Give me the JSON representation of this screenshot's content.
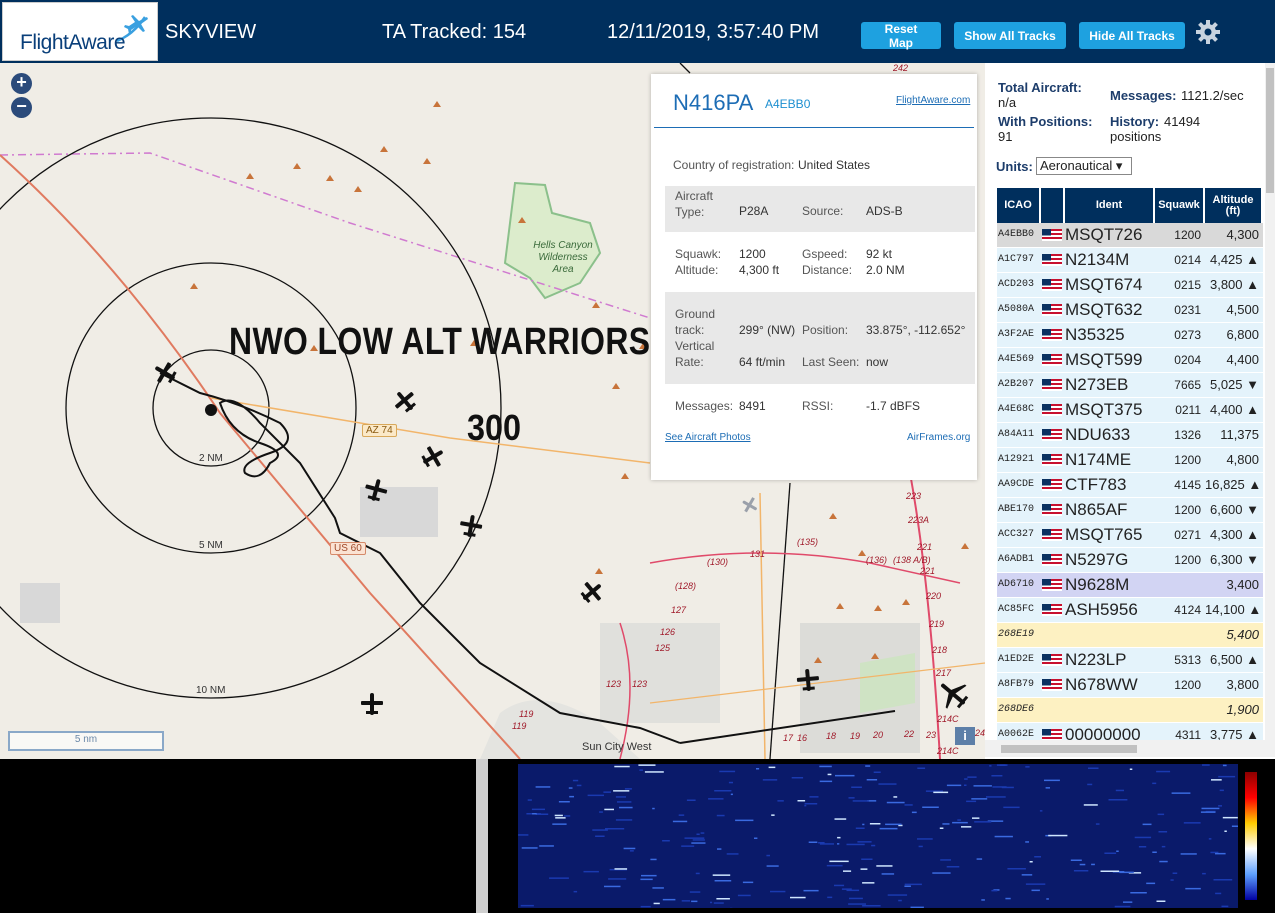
{
  "header": {
    "logo": "FlightAware",
    "app_name": "SKYVIEW",
    "tracked": "TA Tracked: 154",
    "datetime": "12/11/2019, 3:57:40 PM",
    "buttons": {
      "reset": "Reset Map",
      "show": "Show All Tracks",
      "hide": "Hide All Tracks"
    },
    "settings_icon": "gear-icon"
  },
  "map": {
    "zoom_in": "+",
    "zoom_out": "−",
    "overlay_title": "NWO LOW ALT WARRIORS",
    "overlay_number": "300",
    "rings": [
      "2 NM",
      "5 NM",
      "10 NM"
    ],
    "scale": "5 nm",
    "labels": {
      "wilderness": "Hells Canyon Wilderness Area",
      "city": "Sun City West",
      "az74": "AZ 74",
      "us60": "US 60",
      "road_242": "242",
      "route_numbers": [
        "(130)",
        "131",
        "(135)",
        "(136)",
        "(138 A/B)",
        "(128)",
        "127",
        "126",
        "125",
        "123",
        "123",
        "119",
        "119",
        "223",
        "223A",
        "221",
        "221",
        "220",
        "219",
        "218",
        "217",
        "214C",
        "214C",
        "17",
        "16",
        "18",
        "19",
        "20",
        "22",
        "23",
        "24"
      ],
      "info": "i"
    }
  },
  "popup": {
    "registration": "N416PA",
    "hex": "A4EBB0",
    "fa_link": "FlightAware.com",
    "country_label": "Country of registration:",
    "country": "United States",
    "aircraft_type_label": "Aircraft Type:",
    "aircraft_type": "P28A",
    "source_label": "Source:",
    "source": "ADS-B",
    "squawk_label": "Squawk:",
    "squawk": "1200",
    "gspeed_label": "Gspeed:",
    "gspeed": "92 kt",
    "altitude_label": "Altitude:",
    "altitude": "4,300 ft",
    "distance_label": "Distance:",
    "distance": "2.0 NM",
    "ground_track_label": "Ground track:",
    "ground_track": "299° (NW)",
    "position_label": "Position:",
    "position": "33.875°, -112.652°",
    "vrate_label": "Vertical Rate:",
    "vrate": "64 ft/min",
    "last_seen_label": "Last Seen:",
    "last_seen": "now",
    "messages_label": "Messages:",
    "messages": "8491",
    "rssi_label": "RSSI:",
    "rssi": "-1.7 dBFS",
    "photos_link": "See Aircraft Photos",
    "airframes_link": "AirFrames.org"
  },
  "stats": {
    "total_label": "Total Aircraft:",
    "total": "n/a",
    "messages_label": "Messages:",
    "messages": "1121.2/sec",
    "positions_label": "With Positions:",
    "positions": "91",
    "history_label": "History:",
    "history": "41494 positions",
    "units_label": "Units:",
    "units": "Aeronautical ▾"
  },
  "table": {
    "headers": {
      "icao": "ICAO",
      "ident": "Ident",
      "squawk": "Squawk",
      "altitude": "Altitude (ft)"
    },
    "rows": [
      {
        "icao": "A4EBB0",
        "flag": true,
        "ident": "MSQT726",
        "squawk": "1200",
        "alt": "4,300",
        "style": "selected"
      },
      {
        "icao": "A1C797",
        "flag": true,
        "ident": "N2134M",
        "squawk": "0214",
        "alt": "4,425 ▲",
        "style": "normal"
      },
      {
        "icao": "ACD203",
        "flag": true,
        "ident": "MSQT674",
        "squawk": "0215",
        "alt": "3,800 ▲",
        "style": "normal"
      },
      {
        "icao": "A5080A",
        "flag": true,
        "ident": "MSQT632",
        "squawk": "0231",
        "alt": "4,500",
        "style": "normal"
      },
      {
        "icao": "A3F2AE",
        "flag": true,
        "ident": "N35325",
        "squawk": "0273",
        "alt": "6,800",
        "style": "normal"
      },
      {
        "icao": "A4E569",
        "flag": true,
        "ident": "MSQT599",
        "squawk": "0204",
        "alt": "4,400",
        "style": "normal"
      },
      {
        "icao": "A2B207",
        "flag": true,
        "ident": "N273EB",
        "squawk": "7665",
        "alt": "5,025 ▼",
        "style": "normal"
      },
      {
        "icao": "A4E68C",
        "flag": true,
        "ident": "MSQT375",
        "squawk": "0211",
        "alt": "4,400 ▲",
        "style": "normal"
      },
      {
        "icao": "A84A11",
        "flag": true,
        "ident": "NDU633",
        "squawk": "1326",
        "alt": "11,375",
        "style": "normal"
      },
      {
        "icao": "A12921",
        "flag": true,
        "ident": "N174ME",
        "squawk": "1200",
        "alt": "4,800",
        "style": "normal"
      },
      {
        "icao": "AA9CDE",
        "flag": true,
        "ident": "CTF783",
        "squawk": "4145",
        "alt": "16,825 ▲",
        "style": "normal"
      },
      {
        "icao": "ABE170",
        "flag": true,
        "ident": "N865AF",
        "squawk": "1200",
        "alt": "6,600 ▼",
        "style": "normal"
      },
      {
        "icao": "ACC327",
        "flag": true,
        "ident": "MSQT765",
        "squawk": "0271",
        "alt": "4,300 ▲",
        "style": "normal"
      },
      {
        "icao": "A6ADB1",
        "flag": true,
        "ident": "N5297G",
        "squawk": "1200",
        "alt": "6,300 ▼",
        "style": "normal"
      },
      {
        "icao": "AD6710",
        "flag": true,
        "ident": "N9628M",
        "squawk": "",
        "alt": "3,400",
        "style": "nopos"
      },
      {
        "icao": "AC85FC",
        "flag": true,
        "ident": "ASH5956",
        "squawk": "4124",
        "alt": "14,100 ▲",
        "style": "normal"
      },
      {
        "icao": "268E19",
        "flag": false,
        "ident": "",
        "squawk": "",
        "alt": "5,400",
        "style": "mlat"
      },
      {
        "icao": "A1ED2E",
        "flag": true,
        "ident": "N223LP",
        "squawk": "5313",
        "alt": "6,500 ▲",
        "style": "normal"
      },
      {
        "icao": "A8FB79",
        "flag": true,
        "ident": "N678WW",
        "squawk": "1200",
        "alt": "3,800",
        "style": "normal"
      },
      {
        "icao": "268DE6",
        "flag": false,
        "ident": "",
        "squawk": "",
        "alt": "1,900",
        "style": "mlat"
      },
      {
        "icao": "A0062E",
        "flag": true,
        "ident": "00000000",
        "squawk": "4311",
        "alt": "3,775 ▲",
        "style": "normal"
      }
    ]
  },
  "colors": {
    "header_bg": "#002f5d",
    "button_bg": "#1ea1e0",
    "row_normal": "#e4f3fb",
    "row_selected": "#d9d9d9",
    "row_nopos": "#d2d4f3",
    "row_mlat": "#fdf1c2"
  }
}
